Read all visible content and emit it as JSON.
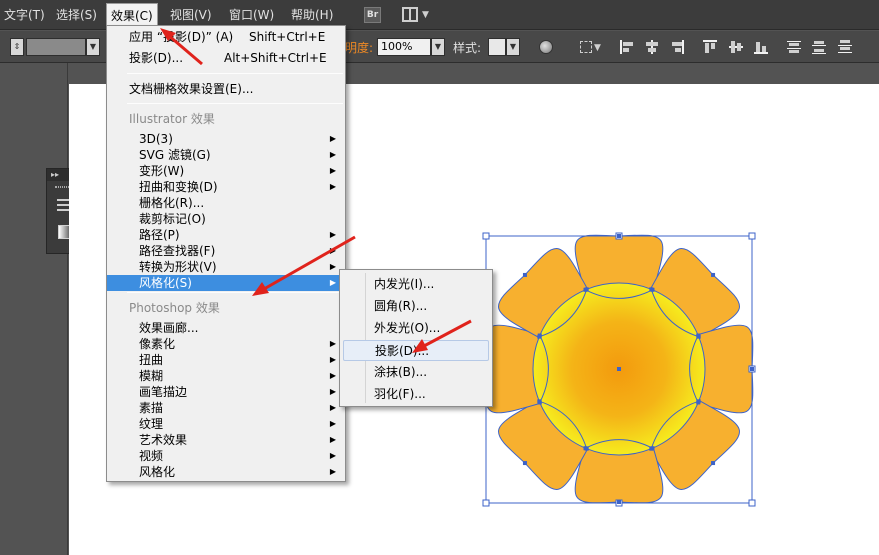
{
  "menubar": {
    "items": [
      "文字(T)",
      "选择(S)",
      "效果(C)",
      "视图(V)",
      "窗口(W)",
      "帮助(H)"
    ],
    "bridge_badge": "Br"
  },
  "controlbar": {
    "opacity_label": "明度:",
    "opacity_value": "100%",
    "style_label": "样式:"
  },
  "effect_menu": {
    "apply_label": "应用 “投影(D)” (A)",
    "apply_shortcut": "Shift+Ctrl+E",
    "last_label": "投影(D)...",
    "last_shortcut": "Alt+Shift+Ctrl+E",
    "raster_settings": "文档栅格效果设置(E)...",
    "illustrator_header": "Illustrator 效果",
    "illustrator_items": [
      {
        "label": "3D(3)",
        "submenu": true
      },
      {
        "label": "SVG 滤镜(G)",
        "submenu": true
      },
      {
        "label": "变形(W)",
        "submenu": true
      },
      {
        "label": "扭曲和变换(D)",
        "submenu": true
      },
      {
        "label": "栅格化(R)...",
        "submenu": false
      },
      {
        "label": "裁剪标记(O)",
        "submenu": false
      },
      {
        "label": "路径(P)",
        "submenu": true
      },
      {
        "label": "路径查找器(F)",
        "submenu": true
      },
      {
        "label": "转换为形状(V)",
        "submenu": true
      },
      {
        "label": "风格化(S)",
        "submenu": true,
        "highlighted": true
      }
    ],
    "photoshop_header": "Photoshop 效果",
    "photoshop_items": [
      {
        "label": "效果画廊...",
        "submenu": false
      },
      {
        "label": "像素化",
        "submenu": true
      },
      {
        "label": "扭曲",
        "submenu": true
      },
      {
        "label": "模糊",
        "submenu": true
      },
      {
        "label": "画笔描边",
        "submenu": true
      },
      {
        "label": "素描",
        "submenu": true
      },
      {
        "label": "纹理",
        "submenu": true
      },
      {
        "label": "艺术效果",
        "submenu": true
      },
      {
        "label": "视频",
        "submenu": true
      },
      {
        "label": "风格化",
        "submenu": true
      }
    ]
  },
  "stylize_submenu": {
    "items": [
      {
        "label": "内发光(I)..."
      },
      {
        "label": "圆角(R)..."
      },
      {
        "label": "外发光(O)..."
      },
      {
        "label": "投影(D)...",
        "highlighted": true
      },
      {
        "label": "涂抹(B)..."
      },
      {
        "label": "羽化(F)..."
      }
    ]
  },
  "colors": {
    "petal": "#f7b02f",
    "center_outer": "#f6ec1e",
    "center_inner": "#f39a0e",
    "selection": "#3d63c8",
    "menu_highlight": "#3d8ee0",
    "arrow": "#e0231c"
  }
}
